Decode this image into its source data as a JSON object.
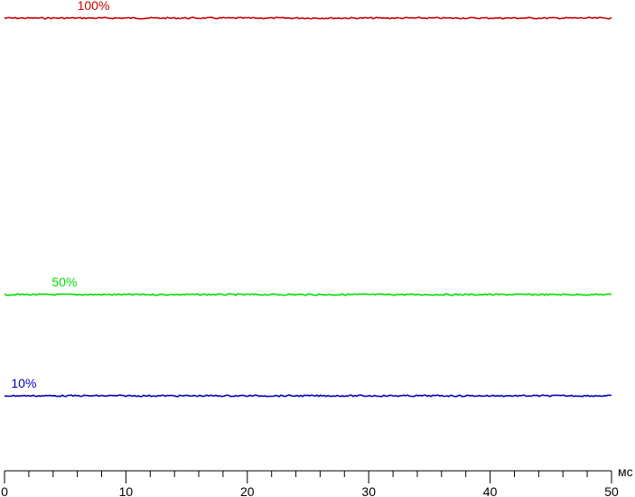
{
  "chart_data": {
    "type": "line",
    "title": "",
    "xlabel": "",
    "ylabel": "",
    "x_unit": "мс",
    "xlim": [
      0,
      50
    ],
    "x_ticks": [
      0,
      10,
      20,
      30,
      40,
      50
    ],
    "ylim": [
      0,
      100
    ],
    "grid": false,
    "series": [
      {
        "name": "100%",
        "level": 100,
        "color": "#cc0000",
        "label_x": 6.0
      },
      {
        "name": "50%",
        "level": 50,
        "color": "#00dd00",
        "label_x": 3.9
      },
      {
        "name": "10%",
        "level": 10,
        "color": "#0000bb",
        "label_x": 0.55
      }
    ]
  }
}
